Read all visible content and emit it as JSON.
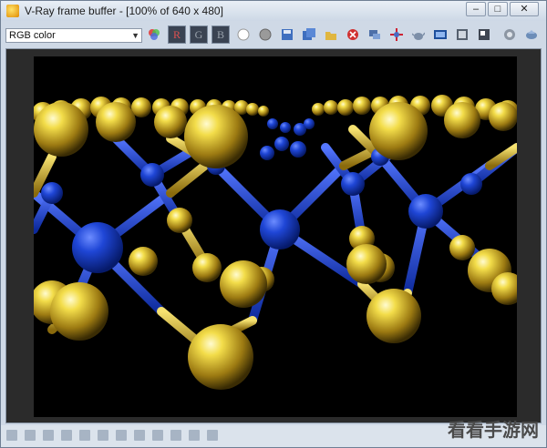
{
  "window": {
    "title": "V-Ray frame buffer - [100% of 640 x 480]"
  },
  "toolbar": {
    "channel_select": {
      "value": "RGB color"
    },
    "channel_buttons": [
      {
        "label": "R",
        "color": "#e05050"
      },
      {
        "label": "G",
        "color": "#9aa3ad"
      },
      {
        "label": "B",
        "color": "#9aa3ad"
      }
    ],
    "icons": [
      "color-picker-icon",
      "show-white-icon",
      "show-gray-icon",
      "save-image-icon",
      "save-all-icon",
      "open-image-icon",
      "clear-image-icon",
      "link-icon",
      "track-mouse-icon",
      "render-teapot-icon",
      "display-correction-icon",
      "pixel-info-icon",
      "stereo-icon",
      "region-render-icon",
      "stop-icon",
      "render-icon"
    ]
  },
  "watermark": "看看手游网",
  "colors": {
    "accent_gold": "#e6c52a",
    "atom_blue": "#1d3fcf",
    "titlebar": "#dfe7f1",
    "render_bg": "#000000"
  }
}
